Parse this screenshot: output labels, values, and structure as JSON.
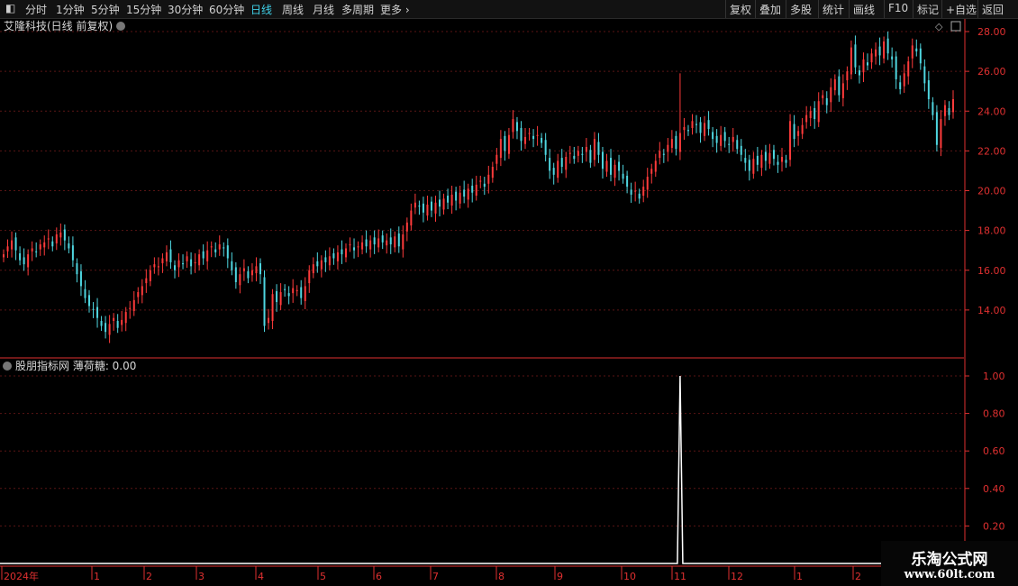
{
  "toolbar": {
    "items": [
      "分时",
      "1分钟",
      "5分钟",
      "15分钟",
      "30分钟",
      "60分钟",
      "日线",
      "周线",
      "月线",
      "多周期",
      "更多"
    ],
    "active": "日线",
    "right_items": [
      "复权",
      "叠加",
      "多股",
      "统计",
      "画线",
      "F10",
      "标记",
      "+自选",
      "返回"
    ]
  },
  "main_panel": {
    "title": "艾隆科技(日线 前复权)"
  },
  "sub_panel": {
    "title": "股朋指标网  薄荷糖: 0.00"
  },
  "watermark": {
    "line1": "乐淘公式网",
    "line2": "www.60lt.com"
  },
  "colors": {
    "up": "#ff3b3b",
    "down": "#4fd6e0",
    "axis": "#e03030",
    "grid": "#5a1515",
    "signal": "#ffffff"
  },
  "chart_data": [
    {
      "type": "candlestick",
      "title": "艾隆科技(日线 前复权)",
      "ylim": [
        12.0,
        28.5
      ],
      "y_ticks": [
        14.0,
        16.0,
        18.0,
        20.0,
        22.0,
        24.0,
        26.0,
        28.0
      ],
      "y_tick_labels": [
        "14.00",
        "16.00",
        "18.00",
        "20.00",
        "22.00",
        "24.00",
        "26.00",
        "28.00"
      ],
      "x_labels": [
        "2024年",
        "1",
        "2",
        "3",
        "4",
        "5",
        "6",
        "7",
        "8",
        "9",
        "10",
        "11",
        "12",
        "1",
        "2"
      ],
      "close": [
        16.8,
        17.2,
        17.5,
        17.0,
        16.5,
        16.3,
        16.8,
        17.1,
        16.9,
        17.3,
        17.4,
        17.6,
        17.2,
        17.8,
        17.9,
        17.5,
        17.1,
        16.5,
        15.8,
        15.2,
        14.6,
        14.2,
        14.0,
        13.6,
        13.2,
        12.9,
        13.3,
        13.6,
        13.1,
        13.5,
        13.9,
        14.1,
        14.5,
        14.9,
        15.2,
        15.6,
        16.0,
        16.3,
        16.2,
        16.6,
        16.9,
        16.4,
        16.0,
        16.5,
        16.3,
        16.7,
        16.2,
        16.4,
        16.8,
        16.6,
        17.0,
        17.2,
        16.9,
        17.3,
        17.1,
        16.6,
        16.0,
        15.4,
        15.8,
        16.1,
        15.6,
        16.0,
        16.2,
        15.8,
        13.2,
        13.6,
        14.8,
        14.4,
        14.9,
        15.0,
        14.7,
        15.1,
        15.0,
        14.6,
        15.2,
        16.0,
        16.3,
        16.2,
        16.5,
        16.4,
        16.7,
        16.6,
        16.9,
        16.8,
        17.1,
        17.3,
        17.0,
        17.2,
        17.4,
        17.2,
        17.5,
        17.3,
        17.6,
        17.4,
        17.5,
        17.3,
        17.7,
        17.2,
        17.8,
        18.4,
        19.0,
        19.4,
        19.2,
        18.9,
        19.3,
        19.0,
        19.4,
        19.2,
        19.6,
        19.4,
        19.8,
        19.5,
        19.9,
        19.7,
        20.1,
        19.9,
        20.3,
        20.5,
        20.2,
        20.8,
        21.2,
        21.8,
        22.6,
        22.0,
        22.8,
        23.6,
        23.0,
        22.5,
        22.7,
        22.9,
        22.6,
        22.8,
        22.4,
        21.8,
        21.0,
        20.8,
        21.5,
        21.2,
        21.7,
        21.9,
        21.6,
        22.0,
        21.8,
        22.2,
        21.4,
        22.6,
        21.8,
        21.1,
        21.5,
        20.8,
        21.3,
        21.0,
        20.6,
        20.2,
        19.8,
        20.0,
        19.6,
        20.2,
        20.7,
        21.1,
        21.5,
        22.0,
        21.8,
        22.3,
        22.6,
        22.1,
        22.9,
        23.2,
        23.0,
        23.5,
        23.3,
        22.9,
        23.4,
        23.1,
        22.6,
        22.4,
        22.8,
        22.5,
        22.3,
        22.7,
        22.1,
        21.8,
        21.4,
        21.0,
        21.6,
        21.3,
        21.8,
        21.5,
        21.9,
        21.6,
        21.3,
        21.7,
        21.4,
        23.5,
        22.6,
        23.0,
        23.3,
        23.8,
        24.0,
        23.6,
        24.5,
        24.8,
        24.3,
        25.2,
        25.6,
        24.8,
        25.4,
        26.0,
        27.2,
        26.2,
        25.8,
        26.6,
        26.3,
        26.9,
        27.1,
        26.8,
        27.5,
        26.9,
        26.6,
        25.6,
        25.1,
        25.9,
        26.5,
        27.3,
        27.0,
        26.4,
        25.4,
        24.6,
        23.8,
        22.3,
        23.6,
        24.3,
        23.8,
        24.6
      ],
      "open_offset_pattern": "alternating",
      "spike_index": 166
    },
    {
      "type": "line",
      "title": "股朋指标网  薄荷糖: 0.00",
      "series": [
        {
          "values_nonzero": [
            {
              "index": 166,
              "value": 1.0
            }
          ],
          "default": 0.0
        }
      ],
      "ylim": [
        0.0,
        1.1
      ],
      "y_ticks": [
        0.2,
        0.4,
        0.6,
        0.8,
        1.0
      ],
      "y_tick_labels": [
        "0.20",
        "0.40",
        "0.60",
        "0.80",
        "1.00"
      ]
    }
  ]
}
